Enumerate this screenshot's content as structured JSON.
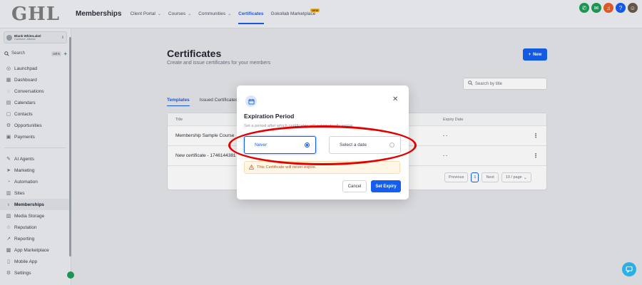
{
  "logo": "GHL",
  "app_name": "Memberships",
  "nav": [
    {
      "label": "Client Portal",
      "chevron": true
    },
    {
      "label": "Courses",
      "chevron": true
    },
    {
      "label": "Communities",
      "chevron": true
    },
    {
      "label": "Certificates",
      "chevron": false,
      "active": true
    },
    {
      "label": "Gokollab Marketplace",
      "chevron": false,
      "badge": "NEW"
    }
  ],
  "top_icons": [
    {
      "name": "phone-icon",
      "color": "#1f9d57",
      "glyph": "✆"
    },
    {
      "name": "megaphone-icon",
      "color": "#1f9d57",
      "glyph": "✉"
    },
    {
      "name": "bell-icon",
      "color": "#e85d2a",
      "glyph": "♫"
    },
    {
      "name": "help-icon",
      "color": "#155eef",
      "glyph": "?"
    },
    {
      "name": "avatar",
      "color": "#6b5b4b",
      "glyph": "☺"
    }
  ],
  "account": {
    "name": "Blank WhiteLabel",
    "location": "Canmore, Alberta"
  },
  "sidebar_search": {
    "label": "Search",
    "shortcut": "ctrl K"
  },
  "menu_group1": [
    {
      "label": "Launchpad",
      "icon": "rocket-icon",
      "glyph": "◎"
    },
    {
      "label": "Dashboard",
      "icon": "dashboard-icon",
      "glyph": "▦"
    },
    {
      "label": "Conversations",
      "icon": "chat-bubble-icon",
      "glyph": "◌"
    },
    {
      "label": "Calendars",
      "icon": "calendar-icon",
      "glyph": "▤"
    },
    {
      "label": "Contacts",
      "icon": "contacts-icon",
      "glyph": "▢"
    },
    {
      "label": "Opportunities",
      "icon": "opportunities-icon",
      "glyph": "⚙"
    },
    {
      "label": "Payments",
      "icon": "payments-icon",
      "glyph": "▣"
    }
  ],
  "menu_group2": [
    {
      "label": "AI Agents",
      "icon": "ai-agents-icon",
      "glyph": "✎"
    },
    {
      "label": "Marketing",
      "icon": "marketing-icon",
      "glyph": "➤"
    },
    {
      "label": "Automation",
      "icon": "automation-icon",
      "glyph": "◔"
    },
    {
      "label": "Sites",
      "icon": "sites-icon",
      "glyph": "▥"
    },
    {
      "label": "Memberships",
      "icon": "memberships-icon",
      "glyph": "♁",
      "active": true
    },
    {
      "label": "Media Storage",
      "icon": "media-storage-icon",
      "glyph": "▨"
    },
    {
      "label": "Reputation",
      "icon": "star-icon",
      "glyph": "☆"
    },
    {
      "label": "Reporting",
      "icon": "reporting-icon",
      "glyph": "↗"
    },
    {
      "label": "App Marketplace",
      "icon": "marketplace-icon",
      "glyph": "▩"
    },
    {
      "label": "Mobile App",
      "icon": "mobile-icon",
      "glyph": "▯"
    },
    {
      "label": "Settings",
      "icon": "gear-icon",
      "glyph": "⚙"
    }
  ],
  "page": {
    "title": "Certificates",
    "subtitle": "Create and issue certificates for your members",
    "new_button": "New",
    "search_placeholder": "Search by title"
  },
  "tabs": [
    {
      "label": "Templates",
      "active": true
    },
    {
      "label": "Issued Certificates",
      "active": false
    }
  ],
  "table": {
    "columns": [
      "Title",
      "Expiry Date"
    ],
    "rows": [
      {
        "title": "Membership Sample Course",
        "expiry": "- -"
      },
      {
        "title": "New certificate - 1746144381",
        "expiry": "- -"
      }
    ],
    "pagination": {
      "prev": "Previous",
      "page": "1",
      "next": "Next",
      "per_page": "10 / page"
    }
  },
  "modal": {
    "title": "Expiration Period",
    "description": "Set a period after which certificates will automatically expire",
    "options": [
      {
        "label": "Never",
        "selected": true
      },
      {
        "label": "Select a date",
        "selected": false
      }
    ],
    "warning": "This Certificate will never expire.",
    "cancel": "Cancel",
    "confirm": "Set Expiry"
  },
  "colors": {
    "primary": "#155eef",
    "annotation": "#e00000",
    "warning_text": "#c4501b",
    "warning_bg": "#fff7e6"
  }
}
